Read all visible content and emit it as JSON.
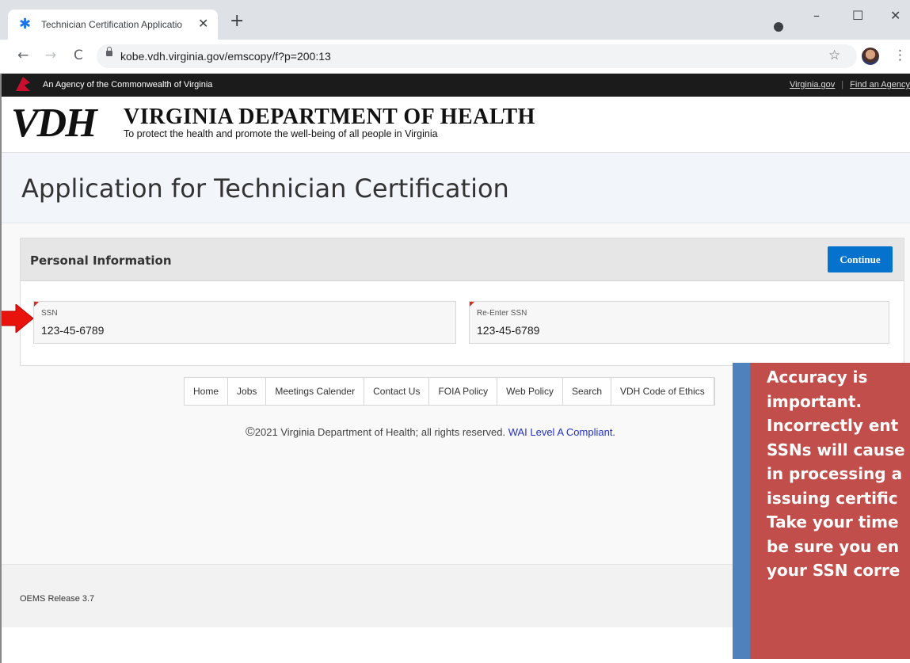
{
  "browser": {
    "tab_title": "Technician Certification Applicatio",
    "tab_close": "✕",
    "new_tab": "+",
    "url": "kobe.vdh.virginia.gov/emscopy/f?p=200:13",
    "window_controls": {
      "minimize": "–",
      "maximize": "☐",
      "close": "✕"
    }
  },
  "agency_bar": {
    "text": "An Agency of the Commonwealth of Virginia",
    "links": [
      "Virginia.gov",
      "Find an Agency"
    ]
  },
  "header": {
    "logo_mark": "VDH",
    "org_name": "VIRGINIA DEPARTMENT OF HEALTH",
    "tagline": "To protect the health and promote the well-being of all people in Virginia"
  },
  "page": {
    "title": "Application for Technician Certification"
  },
  "region": {
    "title": "Personal Information",
    "continue_label": "Continue",
    "fields": [
      {
        "label": "SSN",
        "value": "123-45-6789"
      },
      {
        "label": "Re-Enter SSN",
        "value": "123-45-6789"
      }
    ]
  },
  "footer": {
    "nav": [
      "Home",
      "Jobs",
      "Meetings Calender",
      "Contact Us",
      "FOIA Policy",
      "Web Policy",
      "Search",
      "VDH Code of Ethics"
    ],
    "copyright": "2021 Virginia Department of Health; all rights reserved.",
    "copyright_symbol": "©",
    "wai_link": "WAI Level A Compliant.",
    "release": "OEMS Release 3.7"
  },
  "callout": {
    "lines": [
      "Accuracy is",
      "important.",
      "Incorrectly ent",
      "SSNs will cause",
      "in processing a",
      "issuing certific",
      "Take your time",
      "be sure you en",
      "your SSN corre"
    ],
    "bg_color": "#c24e4b",
    "bar_color": "#4f81bd"
  },
  "icons": {
    "favicon": "star-of-life-icon",
    "back": "←",
    "forward": "→",
    "reload": "C",
    "star": "☆",
    "menu": "⋮"
  }
}
